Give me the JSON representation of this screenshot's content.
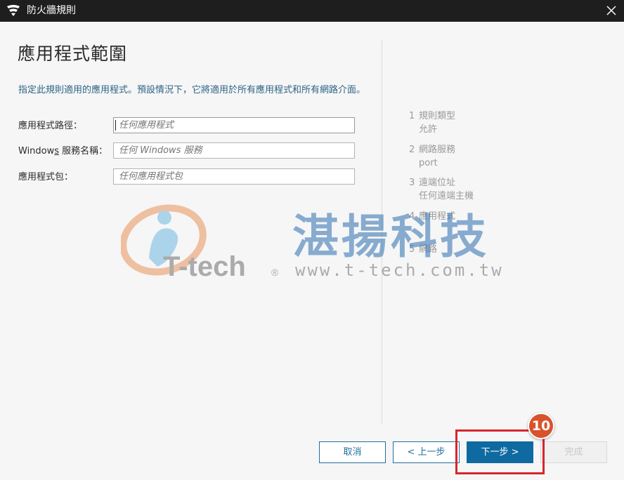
{
  "window": {
    "title": "防火牆規則"
  },
  "page": {
    "title": "應用程式範圍",
    "description": "指定此規則適用的應用程式。預設情況下，它將適用於所有應用程式和所有網路介面。"
  },
  "fields": [
    {
      "label": "應用程式路徑：",
      "placeholder": "任何應用程式"
    },
    {
      "label_pre": "Window",
      "label_u": "s",
      "label_post": " 服務名稱：",
      "placeholder": "任何 Windows 服務"
    },
    {
      "label": "應用程式包：",
      "placeholder": "任何應用程式包"
    }
  ],
  "steps": [
    {
      "num": "1",
      "title": "規則類型",
      "value": "允許"
    },
    {
      "num": "2",
      "title": "網路服務",
      "value": "port"
    },
    {
      "num": "3",
      "title": "遠端位址",
      "value": "任何遠端主機"
    },
    {
      "num": "4",
      "title": "應用程式",
      "value": ""
    },
    {
      "num": "5",
      "title": "網路",
      "value": ""
    }
  ],
  "watermark": {
    "brand": "T-tech",
    "reg": "®",
    "cn": "湛揚科技",
    "url": "www.t-tech.com.tw"
  },
  "buttons": {
    "cancel": "取消",
    "back": "< 上一步",
    "next": "下一步 >",
    "finish": "完成"
  },
  "annotation": {
    "badge": "10"
  },
  "colors": {
    "accent": "#0e6aa0",
    "highlight": "#d9252a",
    "badge": "#d8532c"
  }
}
